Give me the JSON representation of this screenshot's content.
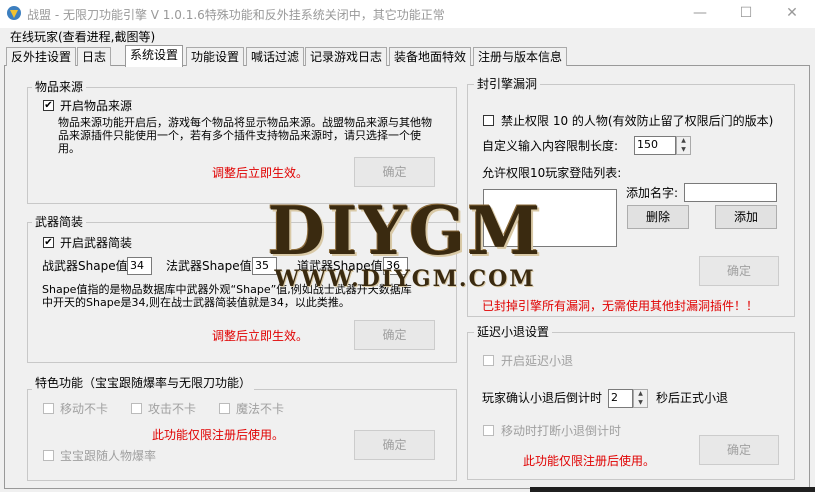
{
  "window": {
    "title": "战盟 - 无限刀功能引擎 V 1.0.1.6特殊功能和反外挂系统关闭中，其它功能正常",
    "minimize": "—",
    "maximize": "☐",
    "close": "✕"
  },
  "menubar": {
    "text": "在线玩家(查看进程,截图等)"
  },
  "tabs": [
    {
      "label": "反外挂设置"
    },
    {
      "label": "日志"
    },
    {
      "label": "系统设置"
    },
    {
      "label": "功能设置"
    },
    {
      "label": "喊话过滤"
    },
    {
      "label": "记录游戏日志"
    },
    {
      "label": "装备地面特效"
    },
    {
      "label": "注册与版本信息"
    }
  ],
  "item_source": {
    "title": "物品来源",
    "enable_label": "开启物品来源",
    "checked": "✔",
    "desc": "物品来源功能开启后，游戏每个物品将显示物品来源。战盟物品来源与其他物品来源插件只能使用一个，若有多个插件支持物品来源时，请只选择一个使用。",
    "notice": "调整后立即生效。",
    "confirm": "确定"
  },
  "weapon": {
    "title": "武器简装",
    "enable_label": "开启武器简装",
    "checked": "✔",
    "warrior_label": "战武器Shape值:",
    "warrior_value": "34",
    "mage_label": "法武器Shape值:",
    "mage_value": "35",
    "taoist_label": "道武器Shape值:",
    "taoist_value": "36",
    "desc": "Shape值指的是物品数据库中武器外观“Shape”值,例如战士武器开天数据库中开天的Shape是34,则在战士武器简装值就是34，以此类推。",
    "notice": "调整后立即生效。",
    "confirm": "确定"
  },
  "special": {
    "title": "特色功能（宝宝跟随爆率与无限刀功能）",
    "move_label": "移动不卡",
    "attack_label": "攻击不卡",
    "magic_label": "魔法不卡",
    "pet_label": "宝宝跟随人物爆率",
    "notice": "此功能仅限注册后使用。",
    "confirm": "确定"
  },
  "seal": {
    "title": "封引擎漏洞",
    "ban_label": "禁止权限 10 的人物(有效防止留了权限后门的版本)",
    "maxlen_label": "自定义输入内容限制长度:",
    "maxlen_value": "150",
    "allow_list_label": "允许权限10玩家登陆列表:",
    "add_name_label": "添加名字:",
    "add_name_value": "",
    "delete": "删除",
    "add": "添加",
    "confirm": "确定",
    "notice": "已封掉引擎所有漏洞，无需使用其他封漏洞插件！！"
  },
  "quit_delay": {
    "title": "延迟小退设置",
    "enable_label": "开启延迟小退",
    "countdown_prefix": "玩家确认小退后倒计时",
    "countdown_value": "2",
    "countdown_suffix": "秒后正式小退",
    "move_interrupt_label": "移动时打断小退倒计时",
    "confirm": "确定",
    "notice": "此功能仅限注册后使用。"
  },
  "watermark": {
    "main": "DIYGM",
    "url": "WWW.DIYGM.COM"
  },
  "colors": {
    "accent_red": "#e00000",
    "disabled_text": "#a0a0a0",
    "panel_bg": "#f0f0f0"
  },
  "icons": [
    "app-icon",
    "check-icon",
    "spin-up-icon",
    "spin-down-icon"
  ]
}
